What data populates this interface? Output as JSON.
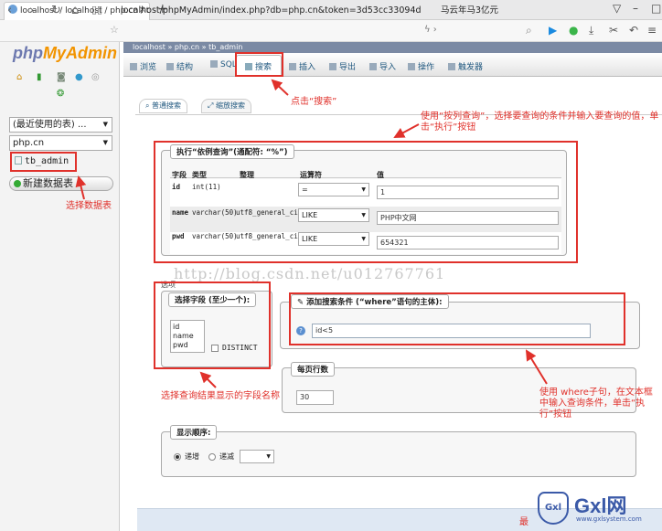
{
  "browser": {
    "tab_title": "localhost / localhost / php.cn / tb",
    "tab_close": "×",
    "new_tab": "+",
    "url": "localhost/phpMyAdmin/index.php?db=php.cn&token=3d53cc33094d",
    "site_button": "马云年马3亿元",
    "back": "‹",
    "forward": "›",
    "reload": "↻",
    "home": "⌂"
  },
  "sidebar": {
    "logo_php": "php",
    "logo_myadmin": "MyAdmin",
    "recent_select": "(最近使用的表) ...",
    "db_select": "php.cn",
    "table_item": "tb_admin",
    "new_db_button": "新建数据表"
  },
  "breadcrumb": "localhost  »  php.cn  »  tb_admin",
  "menu": [
    {
      "label": "浏览"
    },
    {
      "label": "结构"
    },
    {
      "label": "SQL"
    },
    {
      "label": "搜索"
    },
    {
      "label": "插入"
    },
    {
      "label": "导出"
    },
    {
      "label": "导入"
    },
    {
      "label": "操作"
    },
    {
      "label": "触发器"
    }
  ],
  "subtabs": {
    "normal_search": "普通搜索",
    "zoom_search": "缩放搜索"
  },
  "query_by_example": {
    "legend": "执行“依例查询”(通配符: “%”)",
    "headers": {
      "field": "字段",
      "type": "类型",
      "collation": "整理",
      "operator": "运算符",
      "value": "值"
    },
    "rows": [
      {
        "field": "id",
        "type": "int(11)",
        "collation": "",
        "operator": "=",
        "value": "1"
      },
      {
        "field": "name",
        "type": "varchar(50)",
        "collation": "utf8_general_ci",
        "operator": "LIKE",
        "value": "PHP中文网"
      },
      {
        "field": "pwd",
        "type": "varchar(50)",
        "collation": "utf8_general_ci",
        "operator": "LIKE",
        "value": "654321"
      }
    ]
  },
  "options": {
    "label": "选项",
    "select_fields_legend": "选择字段 (至少一个):",
    "field_options": [
      "id",
      "name",
      "pwd"
    ],
    "distinct_label": "DISTINCT",
    "where_legend": "添加搜索条件 (“where”语句的主体):",
    "where_value": "id<5",
    "rows_per_page_legend": "每页行数",
    "rows_per_page_value": "30",
    "order_legend": "显示顺序:",
    "order_asc": "递增",
    "order_desc": "递减"
  },
  "annotations": {
    "click_search": "点击“搜索”",
    "use_query_by_column": "使用“按列查询”，选择要查询的条件并输入要查询的值，单击“执行”按钮",
    "select_table": "选择数据表",
    "select_fields": "选择查询结果显示的字段名称",
    "use_where": "使用 where子句，在文本框中输入查询条件，单击“执行”按钮",
    "bottom_partial": "最"
  },
  "watermark": "http://blog.csdn.net/u012767761",
  "branding": {
    "logo_text": "Gxl网",
    "logo_url": "www.gxlsystem.com"
  },
  "colors": {
    "accent_red": "#e0312b",
    "logo_blue": "#6c78af",
    "logo_orange": "#f29400",
    "link_blue": "#235a81"
  }
}
